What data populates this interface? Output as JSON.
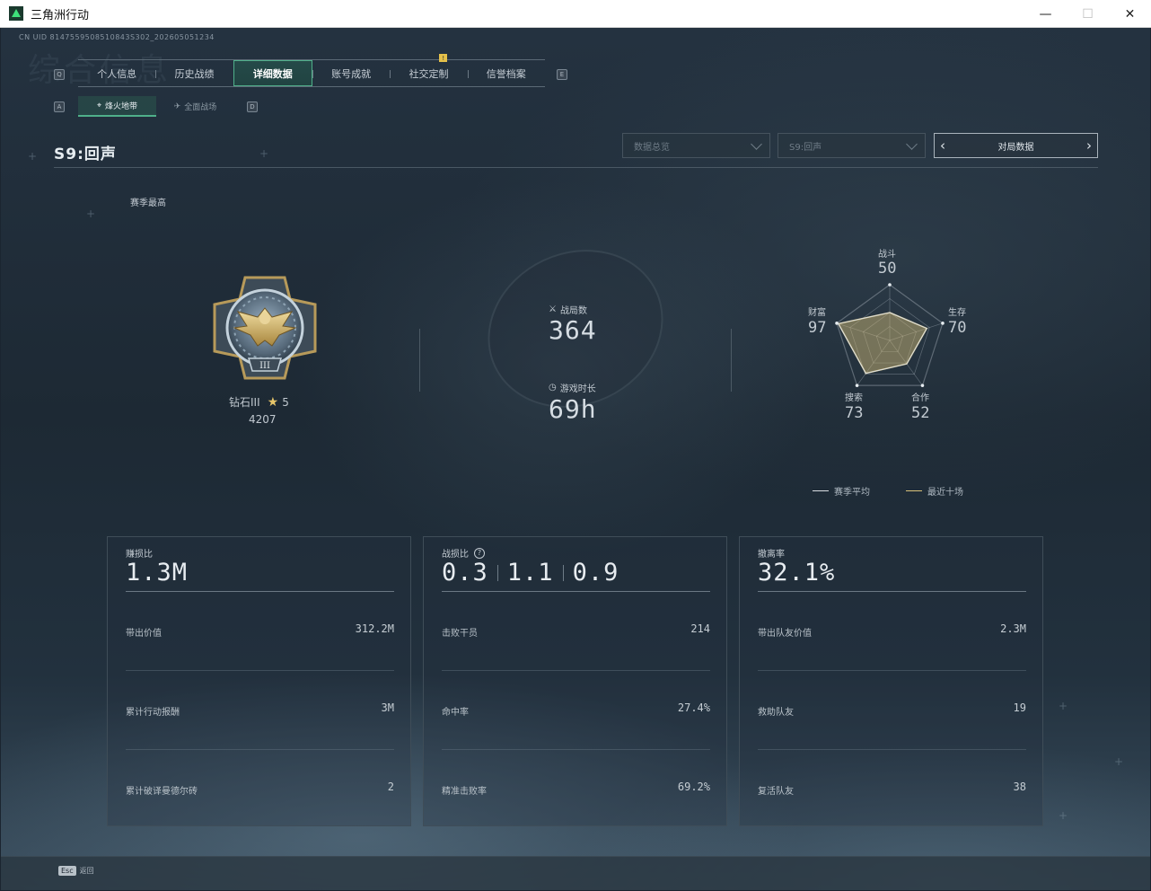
{
  "window": {
    "title": "三角洲行动",
    "controls": {
      "minimize": "—",
      "maximize": "☐",
      "close": "✕"
    }
  },
  "uid_text": "CN UID 8147559508510843S302_202605051234",
  "watermark_text": "综合信息",
  "tabs": [
    {
      "label": "个人信息",
      "active": false
    },
    {
      "label": "历史战绩",
      "active": false
    },
    {
      "label": "详细数据",
      "active": true
    },
    {
      "label": "账号成就",
      "active": false
    },
    {
      "label": "社交定制",
      "active": false,
      "badge": "!"
    },
    {
      "label": "信誉档案",
      "active": false
    }
  ],
  "tab_keys": {
    "prev": "Q",
    "next": "E"
  },
  "subtabs": [
    {
      "label": "烽火地带",
      "active": true,
      "icon": "crosshair-icon"
    },
    {
      "label": "全面战场",
      "active": false,
      "icon": "plane-icon"
    }
  ],
  "subtab_keys": {
    "prev": "A",
    "next": "D"
  },
  "season": {
    "title": "S9:回声",
    "best_label": "赛季最高"
  },
  "filters": {
    "data_type": "数据总览",
    "season_select": "S9:回声",
    "match_data": "对局数据"
  },
  "rank": {
    "name": "钻石III",
    "stars": "5",
    "score": "4207",
    "medal_numeral": "III"
  },
  "summary": {
    "matches_label": "战局数",
    "matches_value": "364",
    "playtime_label": "游戏时长",
    "playtime_value": "69h"
  },
  "radar": {
    "axes": [
      {
        "label": "战斗",
        "value": "50"
      },
      {
        "label": "生存",
        "value": "70"
      },
      {
        "label": "合作",
        "value": "52"
      },
      {
        "label": "搜索",
        "value": "73"
      },
      {
        "label": "财富",
        "value": "97"
      }
    ],
    "legend": [
      {
        "label": "赛季平均",
        "color": "#d9dee2"
      },
      {
        "label": "最近十场",
        "color": "#d9c27a"
      }
    ],
    "recent_fill": "#d9c27a"
  },
  "panels": [
    {
      "label": "赚损比",
      "big": [
        "1.3M"
      ],
      "rows": [
        {
          "key": "带出价值",
          "value": "312.2M"
        },
        {
          "key": "累计行动报酬",
          "value": "3M"
        },
        {
          "key": "累计破译曼德尔砖",
          "value": "2"
        }
      ]
    },
    {
      "label": "战损比",
      "help": "?",
      "big": [
        "0.3",
        "1.1",
        "0.9"
      ],
      "rows": [
        {
          "key": "击败干员",
          "value": "214"
        },
        {
          "key": "命中率",
          "value": "27.4%"
        },
        {
          "key": "精准击败率",
          "value": "69.2%"
        }
      ]
    },
    {
      "label": "撤离率",
      "big": [
        "32.1%"
      ],
      "rows": [
        {
          "key": "带出队友价值",
          "value": "2.3M"
        },
        {
          "key": "救助队友",
          "value": "19"
        },
        {
          "key": "复活队友",
          "value": "38"
        }
      ]
    }
  ],
  "footer": {
    "esc_key": "Esc",
    "back_label": "返回"
  },
  "colors": {
    "accent": "#4fb08a",
    "gold": "#d9c27a",
    "background": "#1b2530"
  }
}
